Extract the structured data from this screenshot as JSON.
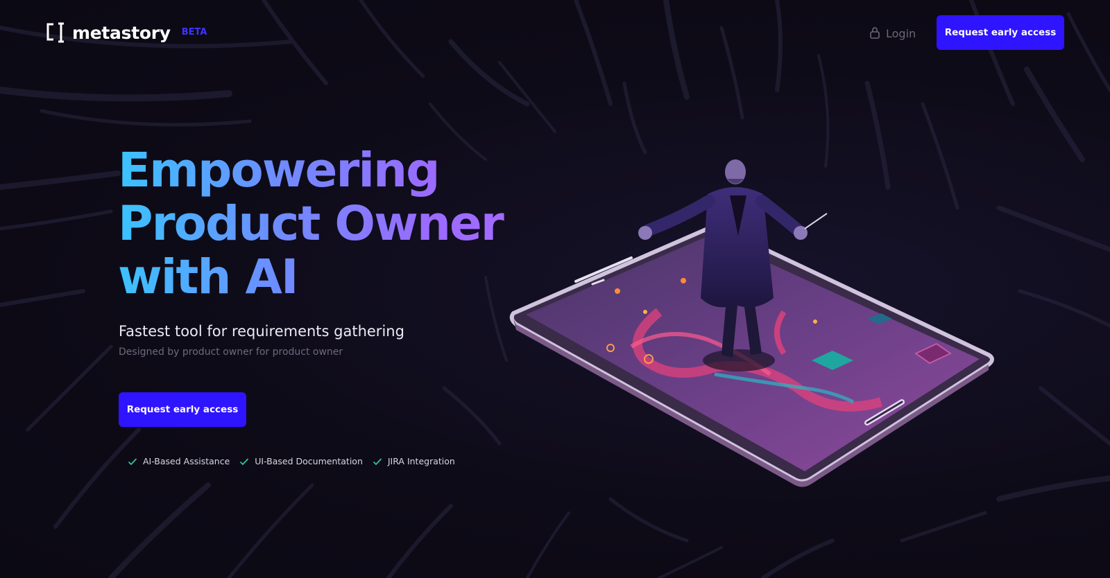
{
  "brand": {
    "name": "metastory",
    "badge": "BETA",
    "badge_color": "#3f34ff"
  },
  "header": {
    "login_label": "Login",
    "login_icon": "lock-icon",
    "cta_label": "Request early access"
  },
  "hero": {
    "title_lines": [
      "Empowering",
      "Product Owner",
      "with AI"
    ],
    "subtitle": "Fastest tool for requirements gathering",
    "tagline": "Designed by product owner for product owner",
    "cta_label": "Request early access",
    "gradient": [
      "#3bc3ff",
      "#6e8cff",
      "#9a6bff",
      "#b06bff"
    ]
  },
  "features": [
    {
      "label": "AI-Based Assistance",
      "icon": "check-icon"
    },
    {
      "label": "UI-Based Documentation",
      "icon": "check-icon"
    },
    {
      "label": "JIRA Integration",
      "icon": "check-icon"
    }
  ],
  "colors": {
    "background": "#0f0c1a",
    "primary_button": "#2f14ff",
    "check": "#2ec4a0"
  }
}
